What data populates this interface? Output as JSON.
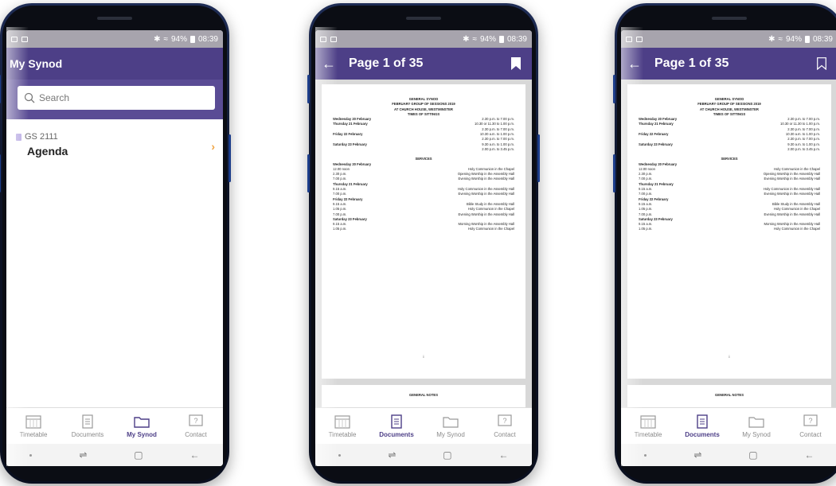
{
  "status": {
    "battery": "94%",
    "time": "08:39"
  },
  "phone1": {
    "title": "My Synod",
    "search_placeholder": "Search",
    "item": {
      "code": "GS 2111",
      "title": "Agenda"
    }
  },
  "doc": {
    "page_indicator": "Page 1 of 35",
    "heading1": "GENERAL SYNOD",
    "heading2": "FEBRUARY GROUP OF SESSIONS 2019",
    "heading3": "AT CHURCH HOUSE, WESTMINSTER",
    "times_heading": "TIMES OF SITTINGS",
    "sittings": [
      {
        "day": "Wednesday 20 February",
        "time": "2.30 p.m. to 7.00 p.m."
      },
      {
        "day": "Thursday 21 February",
        "time": "10.30 or 11.30 to 1.00 p.m."
      },
      {
        "day": "",
        "time": "2.30 p.m. to 7.00 p.m."
      },
      {
        "day": "Friday 22 February",
        "time": "10.30 a.m. to 1.00 p.m."
      },
      {
        "day": "",
        "time": "2.30 p.m. to 7.00 p.m."
      },
      {
        "day": "Saturday 23 February",
        "time": "9.30 a.m. to 1.00 p.m."
      },
      {
        "day": "",
        "time": "2.00 p.m. to 3.45 p.m."
      }
    ],
    "services_heading": "SERVICES",
    "services": [
      {
        "day": "Wednesday 20 February"
      },
      {
        "time": "12.00 noon",
        "desc": "Holy Communion in the Chapel"
      },
      {
        "time": "2.30 p.m.",
        "desc": "Opening Worship in the Assembly Hall"
      },
      {
        "time": "7.00 p.m.",
        "desc": "Evening Worship in the Assembly Hall"
      },
      {
        "day": "Thursday 21 February"
      },
      {
        "time": "9.15 a.m.",
        "desc": "Holy Communion in the Assembly Hall"
      },
      {
        "time": "7.00 p.m.",
        "desc": "Evening Worship in the Assembly Hall"
      },
      {
        "day": "Friday 22 February"
      },
      {
        "time": "9.15 a.m.",
        "desc": "Bible Study in the Assembly Hall"
      },
      {
        "time": "1.05 p.m.",
        "desc": "Holy Communion in the Chapel"
      },
      {
        "time": "7.00 p.m.",
        "desc": "Evening Worship in the Assembly Hall"
      },
      {
        "day": "Saturday 23 February"
      },
      {
        "time": "9.15 a.m.",
        "desc": "Morning Worship in the Assembly Hall"
      },
      {
        "time": "1.05 p.m.",
        "desc": "Holy Communion in the Chapel"
      }
    ],
    "page_number": "i",
    "next_heading": "GENERAL NOTES"
  },
  "tabs": [
    "Timetable",
    "Documents",
    "My Synod",
    "Contact"
  ],
  "active_tab": {
    "phone1": "My Synod",
    "phone2": "Documents",
    "phone3": "Documents"
  },
  "colors": {
    "appbar": "#4d3f87",
    "accent": "#f0a341",
    "active_tab": "#4d3f87"
  }
}
